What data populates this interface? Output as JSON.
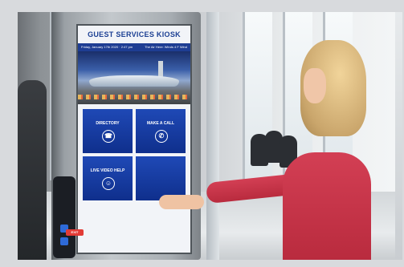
{
  "kiosk": {
    "title": "GUEST SERVICES KIOSK",
    "date_left": "Friday, January 17th 2020  ·  2:47 pm",
    "date_right": "The Air Here: Winds 4 F Wind",
    "tiles": [
      {
        "label": "DIRECTORY",
        "icon": "phone-book-icon"
      },
      {
        "label": "MAKE A CALL",
        "icon": "phone-icon"
      },
      {
        "label": "LIVE VIDEO HELP",
        "icon": "person-icon"
      },
      {
        "label": "",
        "icon": "blank-icon"
      }
    ],
    "exit_label": "EXIT"
  },
  "colors": {
    "kiosk_blue": "#1b3f93",
    "tile_blue": "#1f49b6",
    "shirt_red": "#c8344a",
    "exit_red": "#e23b36"
  }
}
